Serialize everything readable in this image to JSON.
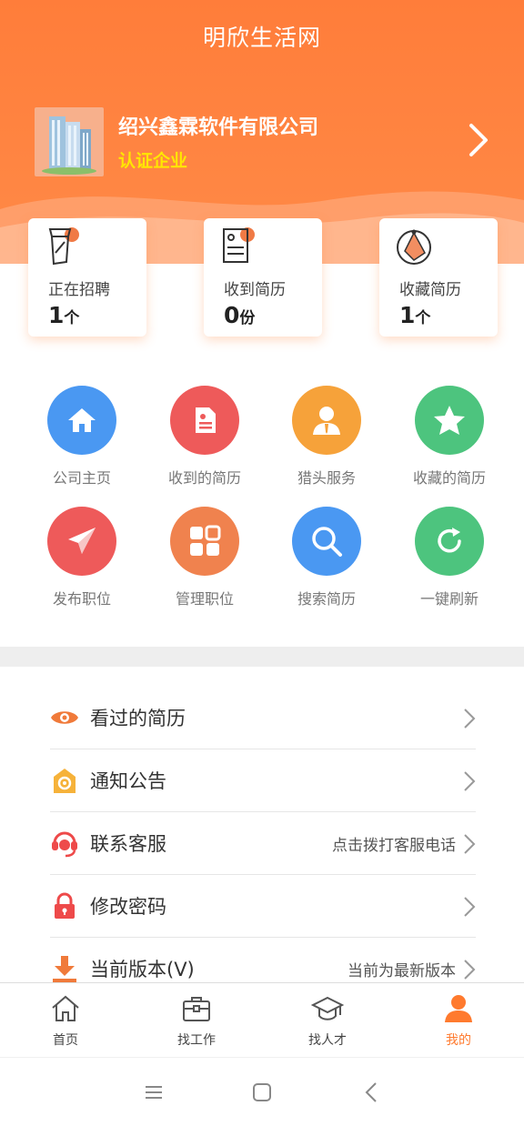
{
  "app": {
    "title": "明欣生活网"
  },
  "company": {
    "name": "绍兴鑫霖软件有限公司",
    "badge": "认证企业"
  },
  "stats": [
    {
      "label": "正在招聘",
      "value": "1",
      "unit": "个",
      "icon": "recruiting-icon"
    },
    {
      "label": "收到简历",
      "value": "0",
      "unit": "份",
      "icon": "resume-icon"
    },
    {
      "label": "收藏简历",
      "value": "1",
      "unit": "个",
      "icon": "favorite-resume-icon"
    }
  ],
  "actions": [
    {
      "label": "公司主页",
      "icon": "home-icon",
      "color": "#4a98f2"
    },
    {
      "label": "收到的简历",
      "icon": "document-icon",
      "color": "#ee5a5a"
    },
    {
      "label": "猎头服务",
      "icon": "person-suit-icon",
      "color": "#f6a23a"
    },
    {
      "label": "收藏的简历",
      "icon": "star-icon",
      "color": "#4dc47e"
    },
    {
      "label": "发布职位",
      "icon": "paper-plane-icon",
      "color": "#ee5a5a"
    },
    {
      "label": "管理职位",
      "icon": "grid-icon",
      "color": "#f0824e"
    },
    {
      "label": "搜索简历",
      "icon": "search-icon",
      "color": "#4a98f2"
    },
    {
      "label": "一键刷新",
      "icon": "refresh-icon",
      "color": "#4dc47e"
    }
  ],
  "menu": [
    {
      "label": "看过的简历",
      "value": "",
      "icon": "eye-icon"
    },
    {
      "label": "通知公告",
      "value": "",
      "icon": "notice-icon"
    },
    {
      "label": "联系客服",
      "value": "点击拨打客服电话",
      "icon": "headset-icon"
    },
    {
      "label": "修改密码",
      "value": "",
      "icon": "lock-icon"
    },
    {
      "label": "当前版本(V)",
      "value": "当前为最新版本",
      "icon": "download-icon"
    }
  ],
  "tabs": [
    {
      "label": "首页",
      "icon": "home-outline-icon"
    },
    {
      "label": "找工作",
      "icon": "briefcase-icon"
    },
    {
      "label": "找人才",
      "icon": "graduation-cap-icon"
    },
    {
      "label": "我的",
      "icon": "user-icon",
      "active": true
    }
  ],
  "colors": {
    "primary": "#ff7d3a",
    "badge": "#ffe600",
    "active_tab": "#ff7a2e"
  }
}
